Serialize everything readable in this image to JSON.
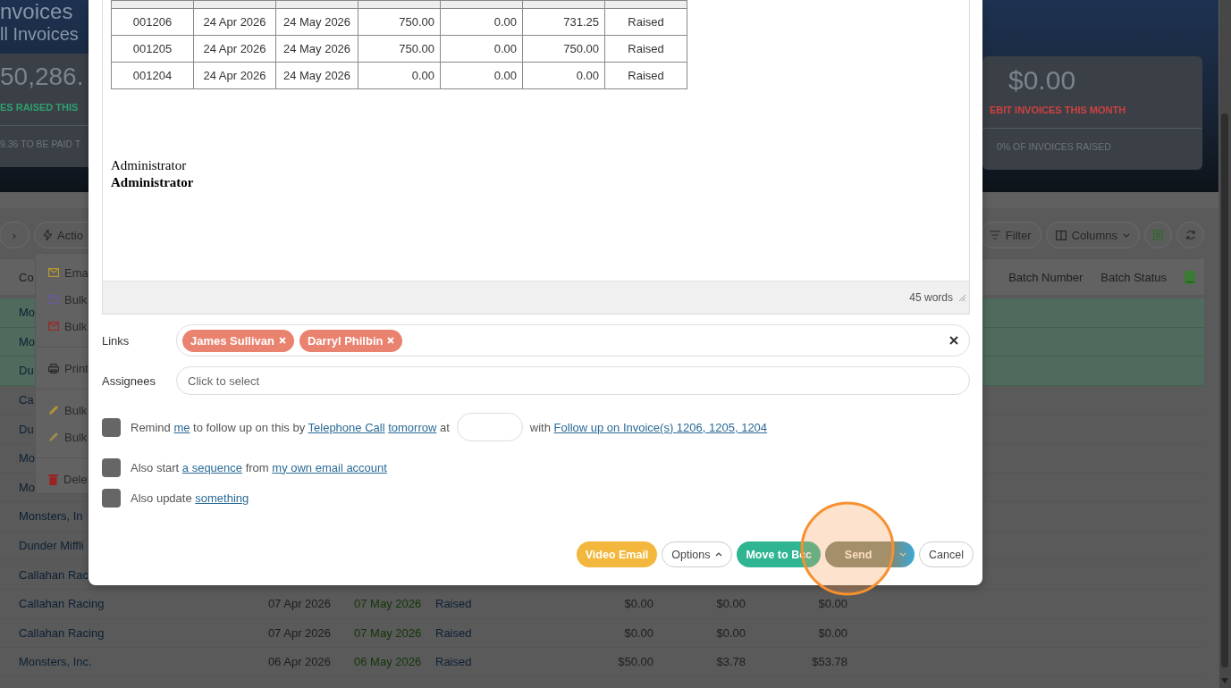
{
  "page": {
    "title": "nvoices",
    "subtitle": "ll Invoices"
  },
  "stat_cards": [
    {
      "value": "50,286.",
      "caption": "ES RAISED THIS",
      "footer": "9.36 TO BE PAID T"
    },
    {
      "value": "$0.00",
      "caption": "EBIT INVOICES THIS MONTH",
      "footer": "0% OF INVOICES RAISED"
    }
  ],
  "toolbar": {
    "pager_label": "›",
    "action_label": "Actio",
    "filter_label": "Filter",
    "columns_label": "Columns"
  },
  "table": {
    "columns_left": [
      "Co"
    ],
    "columns_right": [
      "Batch Number",
      "Batch Status"
    ],
    "rows": [
      {
        "cells": [
          "Mo"
        ],
        "selected": true
      },
      {
        "cells": [
          "Mo"
        ],
        "selected": true
      },
      {
        "cells": [
          "Du"
        ],
        "selected": true
      },
      {
        "cells": [
          "Ca"
        ],
        "selected": false
      },
      {
        "cells": [
          "Du"
        ],
        "selected": false
      },
      {
        "cells": [
          "Mo"
        ],
        "selected": false
      },
      {
        "cells": [
          "Mo"
        ],
        "selected": false
      },
      {
        "cells": [
          "Monsters, In"
        ],
        "selected": false
      },
      {
        "cells": [
          "Dunder Miffli"
        ],
        "selected": false
      },
      {
        "cells": [
          "Callahan Rac"
        ],
        "selected": false
      },
      {
        "cells": [
          "Callahan Racing",
          "07 Apr 2026",
          "07 May 2026",
          "Raised",
          "$0.00",
          "$0.00",
          "$0.00"
        ],
        "selected": false
      },
      {
        "cells": [
          "Callahan Racing",
          "07 Apr 2026",
          "07 May 2026",
          "Raised",
          "$0.00",
          "$0.00",
          "$0.00"
        ],
        "selected": false
      },
      {
        "cells": [
          "Monsters, Inc.",
          "06 Apr 2026",
          "06 May 2026",
          "Raised",
          "$50.00",
          "$3.78",
          "$53.78"
        ],
        "selected": false
      }
    ]
  },
  "action_menu": [
    {
      "label": "Ema",
      "kind": "envelope",
      "color": "#b8962e",
      "divider_before": false
    },
    {
      "label": "Bulk",
      "kind": "envelope",
      "color": "#6a5a9a",
      "divider_before": false
    },
    {
      "label": "Bulk",
      "kind": "envelope",
      "color": "#9a2a2a",
      "divider_before": false
    },
    {
      "label": "Print",
      "kind": "printer",
      "color": "#2a2a2a",
      "divider_before": true
    },
    {
      "label": "Bulk",
      "kind": "pencil",
      "color": "#b8962e",
      "divider_before": true
    },
    {
      "label": "Bulk",
      "kind": "pencil",
      "color": "#a08a50",
      "divider_before": false
    },
    {
      "label": "Dele",
      "kind": "trash",
      "color": "#9a2222",
      "divider_before": true
    }
  ],
  "email": {
    "invoice_rows": [
      [
        "001206",
        "24 Apr 2026",
        "24 May 2026",
        "750.00",
        "0.00",
        "731.25",
        "Raised"
      ],
      [
        "001205",
        "24 Apr 2026",
        "24 May 2026",
        "750.00",
        "0.00",
        "750.00",
        "Raised"
      ],
      [
        "001204",
        "24 Apr 2026",
        "24 May 2026",
        "0.00",
        "0.00",
        "0.00",
        "Raised"
      ]
    ],
    "signature": [
      {
        "text": "Administrator",
        "bold": false
      },
      {
        "text": "Administrator",
        "bold": true
      }
    ],
    "word_count": "45 words"
  },
  "links": {
    "label": "Links",
    "tags": [
      "James Sullivan",
      "Darryl Philbin"
    ]
  },
  "assignees": {
    "label": "Assignees",
    "placeholder": "Click to select"
  },
  "options": [
    {
      "checked": false,
      "segments": [
        {
          "kind": "sentence",
          "parts": [
            {
              "text": "Remind"
            },
            {
              "text": "me",
              "link": true
            },
            {
              "text": "to follow up on this by"
            },
            {
              "text": "Telephone Call",
              "link": true
            },
            {
              "text": "tomorrow",
              "link": true
            },
            {
              "text": "at"
            }
          ]
        },
        {
          "kind": "input"
        },
        {
          "kind": "sentence",
          "parts": [
            {
              "text": "with"
            },
            {
              "text": "Follow up on Invoice(s) 1206, 1205, 1204",
              "link": true
            }
          ]
        }
      ]
    },
    {
      "checked": false,
      "segments": [
        {
          "kind": "sentence",
          "parts": [
            {
              "text": "Also start"
            },
            {
              "text": "a sequence",
              "link": true
            },
            {
              "text": "from"
            },
            {
              "text": "my own email account",
              "link": true
            }
          ]
        }
      ]
    },
    {
      "checked": false,
      "segments": [
        {
          "kind": "sentence",
          "parts": [
            {
              "text": "Also update"
            },
            {
              "text": "something",
              "link": true
            }
          ]
        }
      ]
    }
  ],
  "buttons": [
    {
      "label": "Video Email",
      "kind": "video"
    },
    {
      "label": "Options",
      "kind": "options"
    },
    {
      "label": "Move to Bcc",
      "kind": "bcc"
    },
    {
      "label": "Send",
      "kind": "send"
    },
    {
      "label": "Cancel",
      "kind": "cancel"
    }
  ]
}
